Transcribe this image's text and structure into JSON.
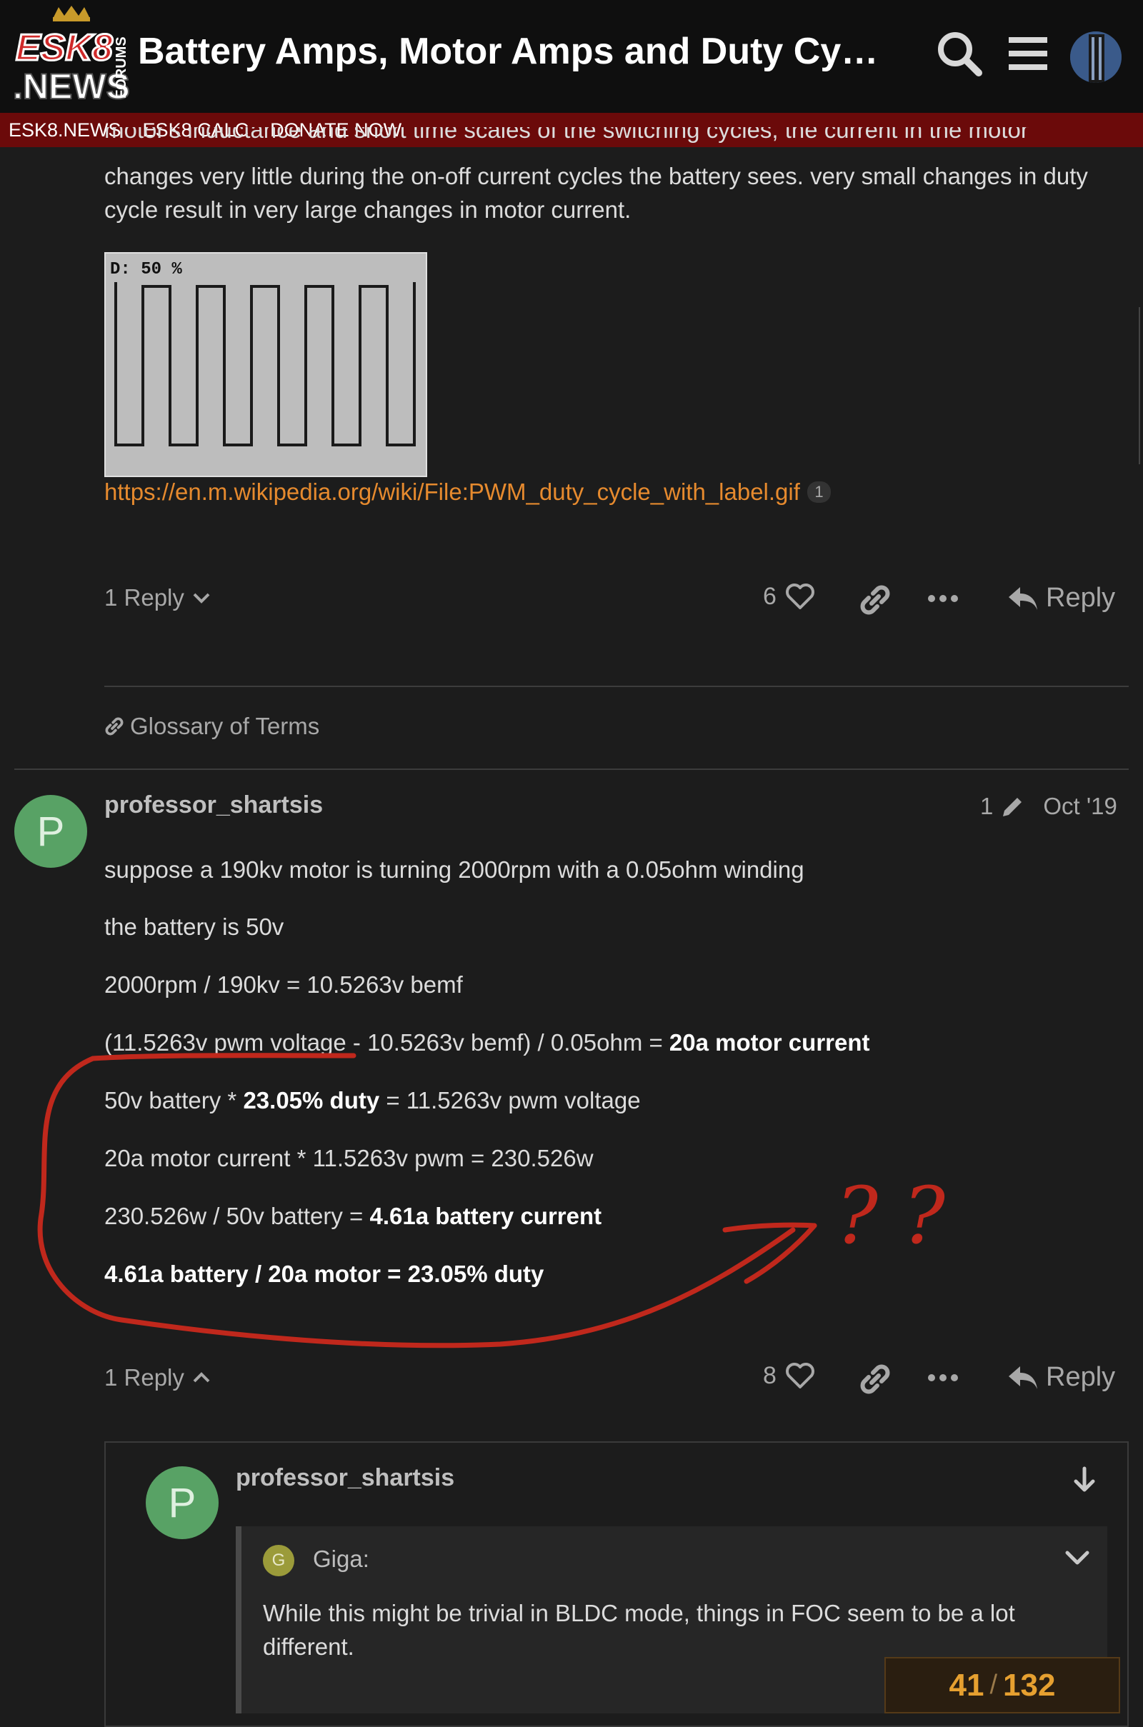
{
  "header": {
    "logo_text": "ESK8 NEWS FORUMS",
    "title": "Battery Amps, Motor Amps and Duty Cycle…"
  },
  "subnav": [
    "ESK8.NEWS",
    "ESK8 CALC",
    "DONATE NOW"
  ],
  "post1": {
    "text_cut": "motor's inductance and short time scales of the switching cycles, the current in the motor",
    "text_line1": "changes very little during the on-off current cycles the battery sees. very small changes in duty",
    "text_line2": "cycle result in very large changes in motor current.",
    "gif_label": "D:  50 %",
    "link": "https://en.m.wikipedia.org/wiki/File:PWM_duty_cycle_with_label.gif",
    "link_clicks": "1",
    "replies_label": "1 Reply",
    "likes": "6",
    "reply_label": "Reply"
  },
  "glossary_link": "Glossary of Terms",
  "post2": {
    "avatar_letter": "P",
    "username": "professor_shartsis",
    "edits": "1",
    "date": "Oct '19",
    "line1": "suppose a 190kv motor is turning 2000rpm with a 0.05ohm winding",
    "line2": "the battery is 50v",
    "line3": "2000rpm / 190kv = 10.5263v bemf",
    "line4_a": "(11.5263v pwm voltage - 10.5263v bemf) / 0.05ohm = ",
    "line4_b": "20a motor current",
    "line5_a": "50v battery * ",
    "line5_b": "23.05% duty",
    "line5_c": " = 11.5263v pwm voltage",
    "line6": "20a motor current * 11.5263v pwm = 230.526w",
    "line7_a": "230.526w / 50v battery = ",
    "line7_b": "4.61a battery current",
    "line8": "4.61a battery / 20a motor = 23.05% duty",
    "annotation": "? ?",
    "replies_label": "1 Reply",
    "likes": "8",
    "reply_label": "Reply"
  },
  "embedded_reply": {
    "avatar_letter": "P",
    "username": "professor_shartsis",
    "quote_avatar_letter": "G",
    "quote_author": "Giga:",
    "quote_line1": "While this might be trivial in BLDC mode, things in FOC seem to be a lot",
    "quote_line2": "different."
  },
  "timeline": {
    "current": "41",
    "separator": "/",
    "total": "132"
  },
  "colors": {
    "background": "#1c1c1c",
    "header": "#0f0f0f",
    "subnav": "#6b0a0a",
    "link": "#e68a2e",
    "avatar_green": "#58a265",
    "annotation_red": "#c0281c",
    "timeline_orange": "#e6a030"
  }
}
